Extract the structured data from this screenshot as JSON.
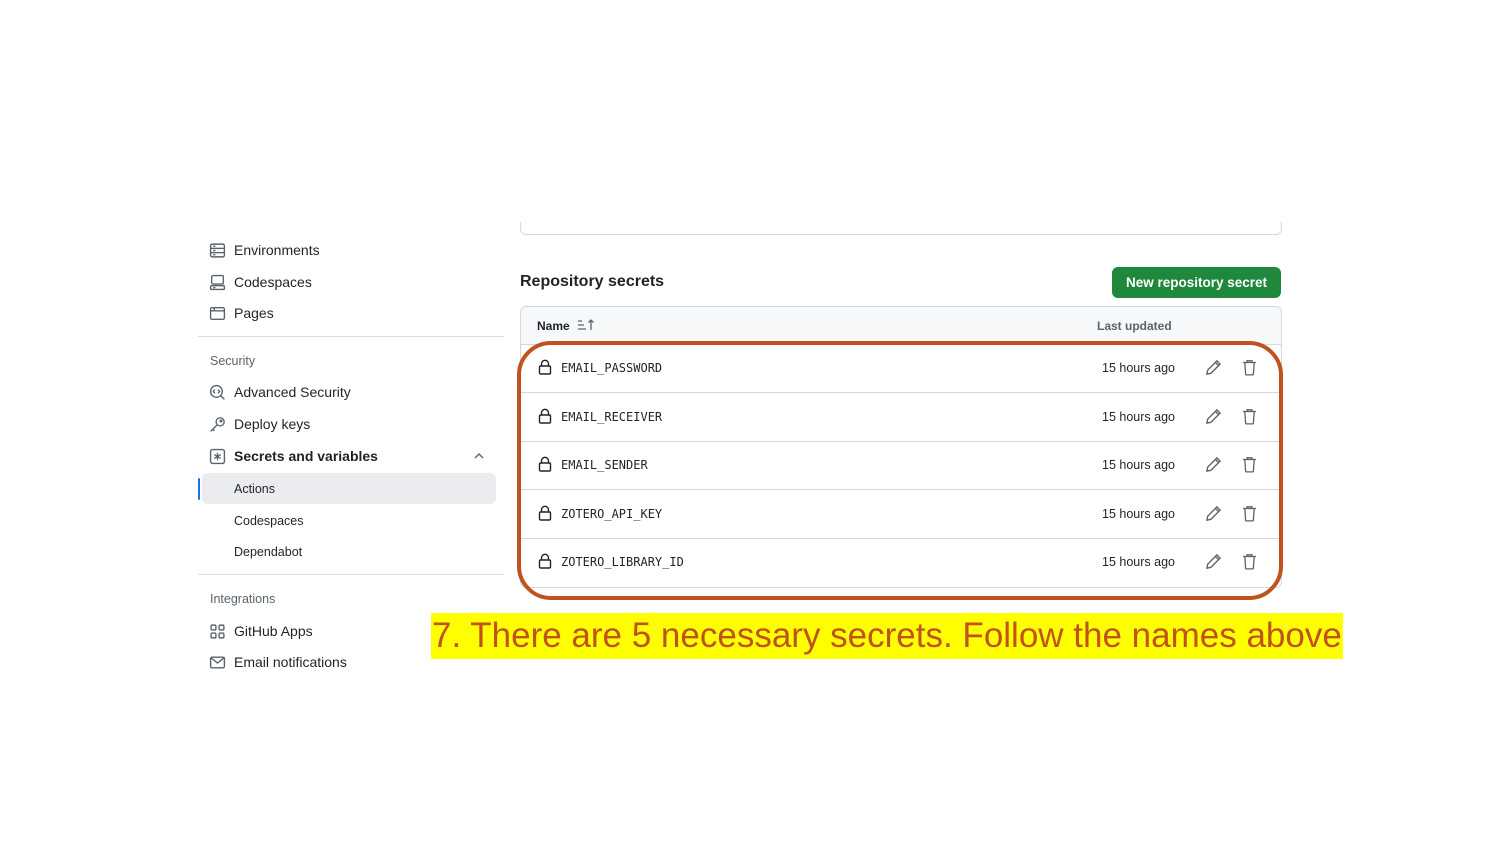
{
  "sidebar": {
    "top_items": [
      {
        "label": "Environments",
        "icon": "server-icon"
      },
      {
        "label": "Codespaces",
        "icon": "codespaces-icon"
      },
      {
        "label": "Pages",
        "icon": "browser-icon"
      }
    ],
    "security": {
      "heading": "Security",
      "items": [
        {
          "label": "Advanced Security",
          "icon": "codescan-icon"
        },
        {
          "label": "Deploy keys",
          "icon": "key-icon"
        },
        {
          "label": "Secrets and variables",
          "icon": "asterisk-box-icon",
          "expanded": true
        }
      ],
      "sub_items": [
        {
          "label": "Actions",
          "active": true
        },
        {
          "label": "Codespaces",
          "active": false
        },
        {
          "label": "Dependabot",
          "active": false
        }
      ]
    },
    "integrations": {
      "heading": "Integrations",
      "items": [
        {
          "label": "GitHub Apps",
          "icon": "apps-icon"
        },
        {
          "label": "Email notifications",
          "icon": "mail-icon"
        }
      ]
    }
  },
  "main": {
    "section_title": "Repository secrets",
    "new_button_label": "New repository secret",
    "table": {
      "col_name": "Name",
      "col_updated": "Last updated",
      "rows": [
        {
          "name": "EMAIL_PASSWORD",
          "updated": "15 hours ago"
        },
        {
          "name": "EMAIL_RECEIVER",
          "updated": "15 hours ago"
        },
        {
          "name": "EMAIL_SENDER",
          "updated": "15 hours ago"
        },
        {
          "name": "ZOTERO_API_KEY",
          "updated": "15 hours ago"
        },
        {
          "name": "ZOTERO_LIBRARY_ID",
          "updated": "15 hours ago"
        }
      ]
    }
  },
  "annotation": {
    "caption": "7. There are 5 necessary secrets. Follow the names above",
    "highlight_color": "#c0521d",
    "caption_bg": "#ffff00"
  },
  "colors": {
    "primary_button": "#1f883d",
    "active_indicator": "#1f6feb"
  }
}
